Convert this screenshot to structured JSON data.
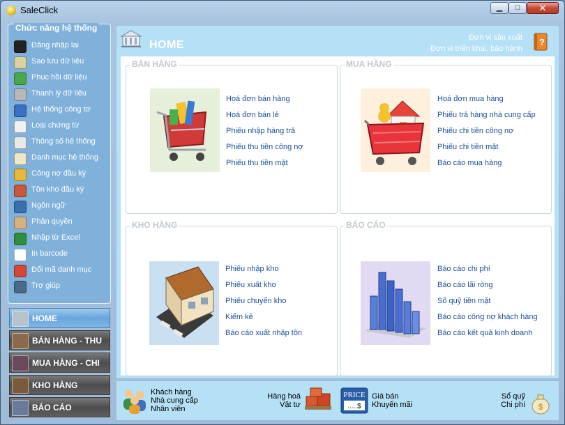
{
  "window": {
    "title": "SaleClick",
    "minimize": "▁",
    "maximize": "□",
    "close": "✕"
  },
  "sidebar": {
    "panel_title": "Chức năng hệ thống",
    "items": [
      {
        "label": "Đăng nhập lại",
        "icon": "login-icon",
        "color": "#222222"
      },
      {
        "label": "Sao lưu dữ liệu",
        "icon": "backup-icon",
        "color": "#d9d2a0"
      },
      {
        "label": "Phục hồi dữ liệu",
        "icon": "restore-icon",
        "color": "#4aa84a"
      },
      {
        "label": "Thanh lý dữ liệu",
        "icon": "database-icon",
        "color": "#b8b8b8"
      },
      {
        "label": "Hệ thống công tơ",
        "icon": "numbers-icon",
        "color": "#3b6fc4"
      },
      {
        "label": "Loại chứng từ",
        "icon": "document-icon",
        "color": "#f0f0f0"
      },
      {
        "label": "Thông số hệ thống",
        "icon": "settings-icon",
        "color": "#e8e8e8"
      },
      {
        "label": "Danh mục hệ thống",
        "icon": "catalog-icon",
        "color": "#f2e6c8"
      },
      {
        "label": "Công nợ đầu kỳ",
        "icon": "debt-icon",
        "color": "#e8b83a"
      },
      {
        "label": "Tồn kho đầu kỳ",
        "icon": "inventory-icon",
        "color": "#c9573a"
      },
      {
        "label": "Ngôn ngữ",
        "icon": "language-icon",
        "color": "#3a6fb0"
      },
      {
        "label": "Phân quyền",
        "icon": "permission-icon",
        "color": "#d8b080"
      },
      {
        "label": "Nhập từ Excel",
        "icon": "excel-icon",
        "color": "#2f8f3f"
      },
      {
        "label": "In barcode",
        "icon": "barcode-icon",
        "color": "#ffffff"
      },
      {
        "label": "Đổi mã danh mục",
        "icon": "change-code-icon",
        "color": "#d8463a"
      },
      {
        "label": "Trợ giúp",
        "icon": "help-icon",
        "color": "#4a6a8a"
      }
    ]
  },
  "nav": [
    {
      "label": "HOME",
      "icon": "home-icon",
      "active": true
    },
    {
      "label": "BÁN HÀNG - THU",
      "icon": "sales-icon",
      "active": false
    },
    {
      "label": "MUA HÀNG - CHI",
      "icon": "purchase-icon",
      "active": false
    },
    {
      "label": "KHO HÀNG",
      "icon": "warehouse-icon",
      "active": false
    },
    {
      "label": "BÁO CÁO",
      "icon": "report-icon",
      "active": false
    }
  ],
  "main": {
    "title": "HOME",
    "top_links": [
      "Đơn vị sản xuất",
      "Đơn vị triển khai, bảo hành"
    ],
    "groups": {
      "ban_hang": {
        "label": "BÁN HÀNG",
        "links": [
          "Hoá đơn bán hàng",
          "Hoá đơn bán lẻ",
          "Phiếu nhập hàng trả",
          "Phiếu thu tiền công nợ",
          "Phiếu thu tiền mặt"
        ]
      },
      "mua_hang": {
        "label": "MUA HÀNG",
        "links": [
          "Hoá đơn mua hàng",
          "Phiếu trả hàng nhà cung cấp",
          "Phiếu chi tiền công nợ",
          "Phiếu chi tiền mặt",
          "Báo cáo mua hàng"
        ]
      },
      "kho_hang": {
        "label": "KHO HÀNG",
        "links": [
          "Phiếu nhập kho",
          "Phiếu xuất kho",
          "Phiếu chuyển kho",
          "Kiểm kê",
          "Báo cáo xuất nhập tồn"
        ]
      },
      "bao_cao": {
        "label": "BÁO CÁO",
        "links": [
          "Báo cáo chi phí",
          "Báo cáo lãi ròng",
          "Sổ quỹ tiền mặt",
          "Báo cáo công nợ khách hàng",
          "Báo cáo kết quả kinh doanh"
        ]
      }
    }
  },
  "bottom": {
    "contacts": [
      "Khách hàng",
      "Nhà cung cấp",
      "Nhân viên"
    ],
    "goods": [
      "Hàng hoá",
      "Vật tư"
    ],
    "price_sign": "PRICE",
    "price_tag": ".....$",
    "prices": [
      "Giá bán",
      "Khuyến mãi"
    ],
    "cash": [
      "Sổ quỹ",
      "Chi phí"
    ]
  }
}
